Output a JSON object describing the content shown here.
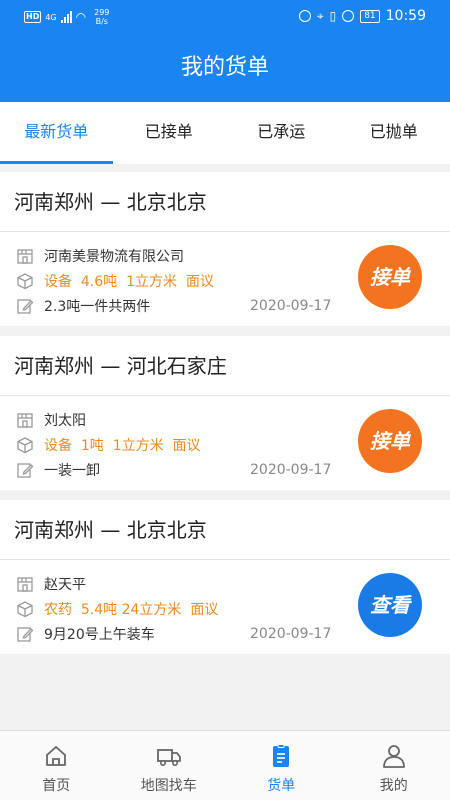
{
  "status_bar": {
    "network": "4G",
    "speed_value": "299",
    "speed_unit": "B/s",
    "battery": "81",
    "time": "10:59"
  },
  "header": {
    "title": "我的货单"
  },
  "tabs": [
    {
      "label": "最新货单",
      "active": true
    },
    {
      "label": "已接单",
      "active": false
    },
    {
      "label": "已承运",
      "active": false
    },
    {
      "label": "已抛单",
      "active": false
    }
  ],
  "orders": [
    {
      "route": "河南郑州 — 北京北京",
      "shipper": "河南美景物流有限公司",
      "cargo": "设备  4.6吨  1立方米  面议",
      "note": "2.3吨一件共两件",
      "date": "2020-09-17",
      "action": "接单",
      "action_color": "#f47320"
    },
    {
      "route": "河南郑州 — 河北石家庄",
      "shipper": "刘太阳",
      "cargo": "设备  1吨  1立方米  面议",
      "note": "一装一卸",
      "date": "2020-09-17",
      "action": "接单",
      "action_color": "#f47320"
    },
    {
      "route": "河南郑州 — 北京北京",
      "shipper": "赵天平",
      "cargo": "农药  5.4吨 24立方米  面议",
      "note": "9月20号上午装车",
      "date": "2020-09-17",
      "action": "查看",
      "action_color": "#1a7ae6"
    }
  ],
  "bottom_nav": [
    {
      "label": "首页",
      "icon": "home-icon",
      "active": false
    },
    {
      "label": "地图找车",
      "icon": "truck-icon",
      "active": false
    },
    {
      "label": "货单",
      "icon": "document-icon",
      "active": true
    },
    {
      "label": "我的",
      "icon": "person-icon",
      "active": false
    }
  ],
  "colors": {
    "primary": "#1a84f0",
    "accent_orange": "#f08a1c",
    "button_orange": "#f47320",
    "button_blue": "#1a7ae6"
  }
}
